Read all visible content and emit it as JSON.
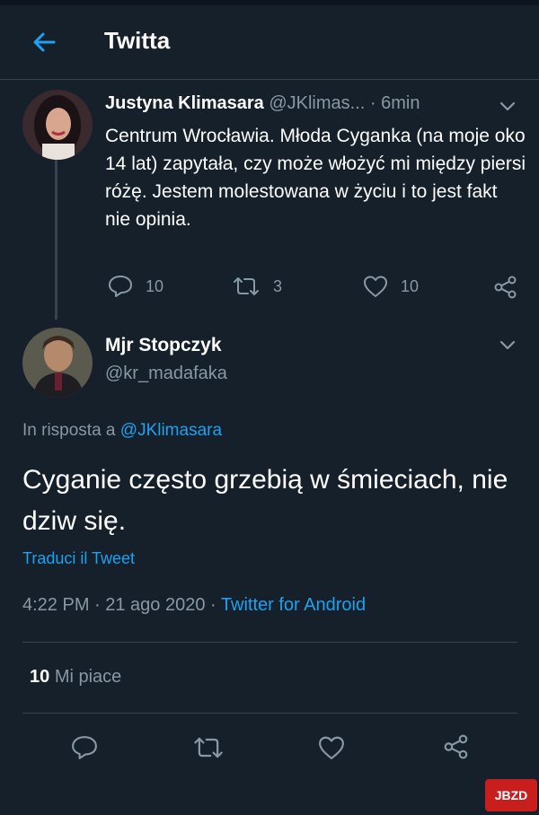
{
  "header": {
    "title": "Twitta",
    "back_icon": "arrow-left-icon"
  },
  "tweet1": {
    "author_name": "Justyna Klimasara",
    "author_handle": "@JKlimas...",
    "separator": "·",
    "time": "6min",
    "text": "Centrum Wrocławia. Młoda Cyganka (na moje oko 14 lat) zapytała, czy może włożyć mi między piersi różę. Jestem molestowana w życiu i to jest fakt nie opinia.",
    "replies": "10",
    "retweets": "3",
    "likes": "10"
  },
  "tweet2": {
    "author_name": "Mjr Stopczyk",
    "author_handle": "@kr_madafaka",
    "reply_prefix": "In risposta a",
    "reply_to": "@JKlimasara",
    "text": "Cyganie często grzebią w śmieciach, nie dziw się.",
    "translate": "Traduci il Tweet",
    "timestamp": "4:22 PM · 21 ago 2020 ·",
    "client": "Twitter for Android",
    "like_count": "10",
    "like_label": "Mi piace"
  },
  "watermark": {
    "text": "JBZD"
  },
  "colors": {
    "background": "#15202b",
    "accent": "#1da1f2",
    "muted": "#8899a6",
    "divider": "#38444d"
  }
}
